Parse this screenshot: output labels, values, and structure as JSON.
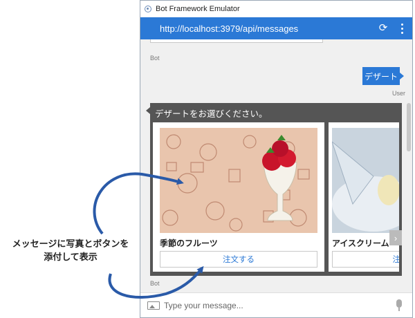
{
  "window": {
    "title": "Bot Framework Emulator",
    "url": "http://localhost:3979/api/messages"
  },
  "chat": {
    "bot_label": "Bot",
    "user_label": "User",
    "user_message": "デザート",
    "bot_message": "デザートをお選びください。",
    "cards": [
      {
        "title": "季節のフルーツ",
        "button": "注文する"
      },
      {
        "title": "アイスクリーム",
        "button": "注"
      }
    ],
    "scroll_right_icon": "chevron-right-icon"
  },
  "input": {
    "placeholder": "Type your message..."
  },
  "annotation": {
    "line1": "メッセージに写真とボタンを",
    "line2": "添付して表示"
  },
  "colors": {
    "accent": "#2b79d6",
    "bot_bubble": "#555555",
    "arrow": "#2a5aa8"
  }
}
